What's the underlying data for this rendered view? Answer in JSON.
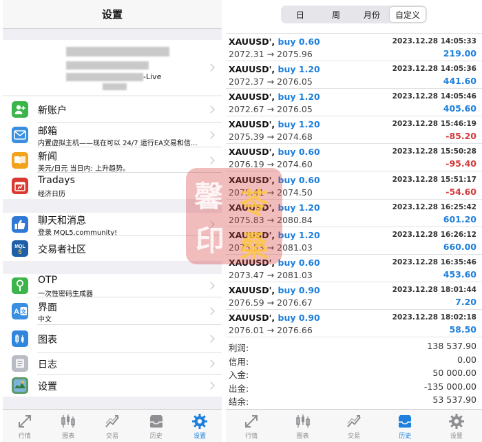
{
  "left": {
    "header": {
      "title": "设置"
    },
    "account": {
      "suffix": "-Live"
    },
    "groups": [
      [
        {
          "name": "new-account",
          "icon": "person-add-icon",
          "icon_bg": "#3cb44a",
          "title": "新账户",
          "sub": ""
        },
        {
          "name": "mail",
          "icon": "mail-icon",
          "icon_bg": "#3a8fe0",
          "title": "邮箱",
          "sub": "内置虚拟主机——现在可以 24/7 运行EA交易和信..."
        },
        {
          "name": "news",
          "icon": "book-icon",
          "icon_bg": "#f2a21b",
          "title": "新闻",
          "sub": "美元/日元 当日内: 上升趋势。"
        },
        {
          "name": "tradays",
          "icon": "calendar-icon",
          "icon_bg": "#d9392f",
          "title": "Tradays",
          "sub": "经济日历"
        }
      ],
      [
        {
          "name": "chat",
          "icon": "thumbs-up-icon",
          "icon_bg": "#2f78d6",
          "title": "聊天和消息",
          "sub": "登录 MQL5.community!"
        },
        {
          "name": "community",
          "icon": "mql5-icon",
          "icon_bg": "#1d5fa8",
          "title": "交易者社区",
          "sub": "",
          "icon_text": "MQL 5"
        }
      ],
      [
        {
          "name": "otp",
          "icon": "key-icon",
          "icon_bg": "#3cb44a",
          "title": "OTP",
          "sub": "一次性密码生成器"
        },
        {
          "name": "interface",
          "icon": "language-icon",
          "icon_bg": "#3a8fe0",
          "title": "界面",
          "sub": "中文",
          "icon_text": "A 文"
        },
        {
          "name": "charts",
          "icon": "candlestick-icon",
          "icon_bg": "#2f86dc",
          "title": "图表",
          "sub": ""
        },
        {
          "name": "journal",
          "icon": "journal-icon",
          "icon_bg": "#b9bcc4",
          "title": "日志",
          "sub": ""
        },
        {
          "name": "settings",
          "icon": "settings-app-icon",
          "icon_bg": "#5a9c6a",
          "title": "设置",
          "sub": ""
        }
      ]
    ],
    "tabbar": [
      {
        "name": "quotes",
        "icon": "quotes-icon",
        "label": "行情",
        "active": false
      },
      {
        "name": "chart",
        "icon": "chart-icon",
        "label": "图表",
        "active": false
      },
      {
        "name": "trade",
        "icon": "trade-icon",
        "label": "交易",
        "active": false
      },
      {
        "name": "history",
        "icon": "history-icon",
        "label": "历史",
        "active": false
      },
      {
        "name": "settings",
        "icon": "gear-icon",
        "label": "设置",
        "active": true
      }
    ]
  },
  "right": {
    "segments": [
      {
        "label": "日",
        "active": false
      },
      {
        "label": "周",
        "active": false
      },
      {
        "label": "月份",
        "active": false
      },
      {
        "label": "自定义",
        "active": true
      }
    ],
    "trades": [
      {
        "symbol": "XAUUSD'",
        "side": "buy 0.60",
        "time": "2023.12.28 14:05:33",
        "prices": "2072.31 → 2075.96",
        "profit": "219.00",
        "positive": true
      },
      {
        "symbol": "XAUUSD'",
        "side": "buy 1.20",
        "time": "2023.12.28 14:05:36",
        "prices": "2072.37 → 2076.05",
        "profit": "441.60",
        "positive": true
      },
      {
        "symbol": "XAUUSD'",
        "side": "buy 1.20",
        "time": "2023.12.28 14:05:46",
        "prices": "2072.67 → 2076.05",
        "profit": "405.60",
        "positive": true
      },
      {
        "symbol": "XAUUSD'",
        "side": "buy 1.20",
        "time": "2023.12.28 15:46:19",
        "prices": "2075.39 → 2074.68",
        "profit": "-85.20",
        "positive": false
      },
      {
        "symbol": "XAUUSD'",
        "side": "buy 0.60",
        "time": "2023.12.28 15:50:28",
        "prices": "2076.19 → 2074.60",
        "profit": "-95.40",
        "positive": false
      },
      {
        "symbol": "XAUUSD'",
        "side": "buy 0.60",
        "time": "2023.12.28 15:51:17",
        "prices": "2075.41 → 2074.50",
        "profit": "-54.60",
        "positive": false
      },
      {
        "symbol": "XAUUSD'",
        "side": "buy 1.20",
        "time": "2023.12.28 16:25:42",
        "prices": "2075.83 → 2080.84",
        "profit": "601.20",
        "positive": true
      },
      {
        "symbol": "XAUUSD'",
        "side": "buy 1.20",
        "time": "2023.12.28 16:26:12",
        "prices": "2075.53 → 2081.03",
        "profit": "660.00",
        "positive": true
      },
      {
        "symbol": "XAUUSD'",
        "side": "buy 0.60",
        "time": "2023.12.28 16:35:46",
        "prices": "2073.47 → 2081.03",
        "profit": "453.60",
        "positive": true
      },
      {
        "symbol": "XAUUSD'",
        "side": "buy 0.90",
        "time": "2023.12.28 18:01:44",
        "prices": "2076.59 → 2076.67",
        "profit": "7.20",
        "positive": true
      },
      {
        "symbol": "XAUUSD'",
        "side": "buy 0.90",
        "time": "2023.12.28 18:02:18",
        "prices": "2076.01 → 2076.66",
        "profit": "58.50",
        "positive": true
      }
    ],
    "summary": [
      {
        "label": "利润:",
        "value": "138 537.90"
      },
      {
        "label": "信用:",
        "value": "0.00"
      },
      {
        "label": "入金:",
        "value": "50 000.00"
      },
      {
        "label": "出金:",
        "value": "-135 000.00"
      },
      {
        "label": "结余:",
        "value": "53 537.90"
      }
    ],
    "tabbar": [
      {
        "name": "quotes",
        "icon": "quotes-icon",
        "label": "行情",
        "active": false
      },
      {
        "name": "chart",
        "icon": "chart-icon",
        "label": "图表",
        "active": false
      },
      {
        "name": "trade",
        "icon": "trade-icon",
        "label": "交易",
        "active": false
      },
      {
        "name": "history",
        "icon": "history-icon",
        "label": "历史",
        "active": true
      },
      {
        "name": "settings",
        "icon": "gear-icon",
        "label": "设置",
        "active": false
      }
    ]
  },
  "seal": {
    "chars": [
      "馨",
      "苓",
      "印",
      "桑"
    ]
  },
  "colors": {
    "accent": "#1e7fdc",
    "negative": "#d23a3a",
    "seal": "#d64040"
  }
}
